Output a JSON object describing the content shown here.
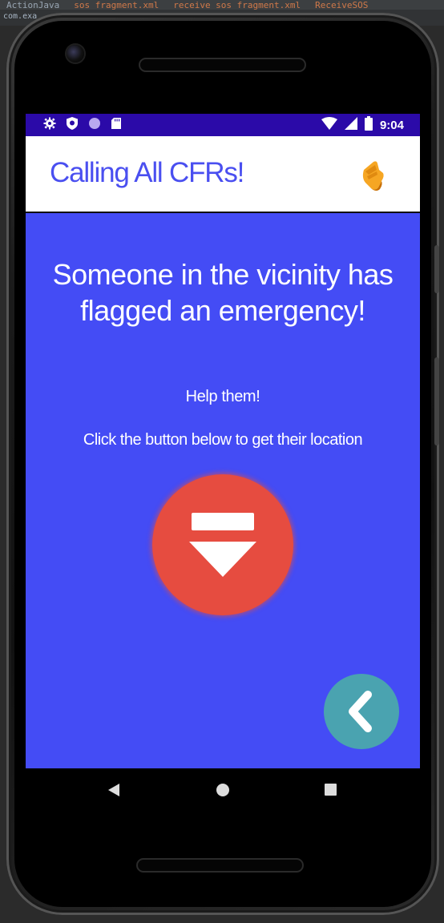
{
  "ide": {
    "tabs": [
      "ActionJava",
      "sos_fragment.xml",
      "receive_sos_fragment.xml",
      "ReceiveSOS"
    ],
    "path": "com.exa"
  },
  "status_bar": {
    "time": "9:04",
    "left_icons": [
      "settings-icon",
      "shield-icon",
      "circle-icon",
      "sd-card-icon"
    ],
    "right_icons": [
      "wifi-icon",
      "signal-icon",
      "battery-icon"
    ],
    "background": "#2b0aa8"
  },
  "app_bar": {
    "title": "Calling All CFRs!",
    "title_color": "#4a4ff0",
    "icon": "raised-hand-icon"
  },
  "content": {
    "headline": "Someone in the vicinity has flagged an emergency!",
    "help": "Help them!",
    "instruction": "Click the button below to get their location",
    "background": "#444cf5"
  },
  "location_button": {
    "icon": "download-arrow-icon",
    "color": "#e64c40"
  },
  "back_button": {
    "icon": "chevron-left-icon",
    "color": "#4aa3b0"
  },
  "nav_bar": {
    "buttons": [
      "back-triangle-icon",
      "home-circle-icon",
      "recents-square-icon"
    ]
  }
}
